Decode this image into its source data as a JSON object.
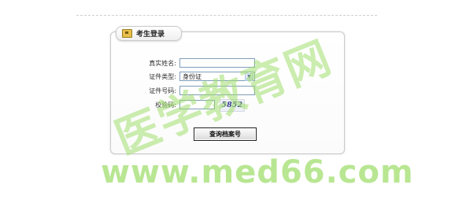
{
  "panel": {
    "title": "考生登录"
  },
  "form": {
    "name_label": "真实姓名:",
    "name_value": "",
    "id_type_label": "证件类型:",
    "id_type_selected": "身份证",
    "id_number_label": "证件号码:",
    "id_number_value": "",
    "captcha_label": "校验码:",
    "captcha_value": "",
    "captcha_image_text": "5852"
  },
  "actions": {
    "query_label": "查询档案号"
  },
  "watermark": {
    "cn_text": "医学教育网",
    "url_text": "www.med66.com"
  },
  "colors": {
    "watermark": "#a0de6e",
    "field_border": "#7f9db9",
    "captcha_text": "#35378f"
  },
  "icons": {
    "panel_icon": "id-card-icon",
    "select_arrow": "chevron-down-icon"
  }
}
